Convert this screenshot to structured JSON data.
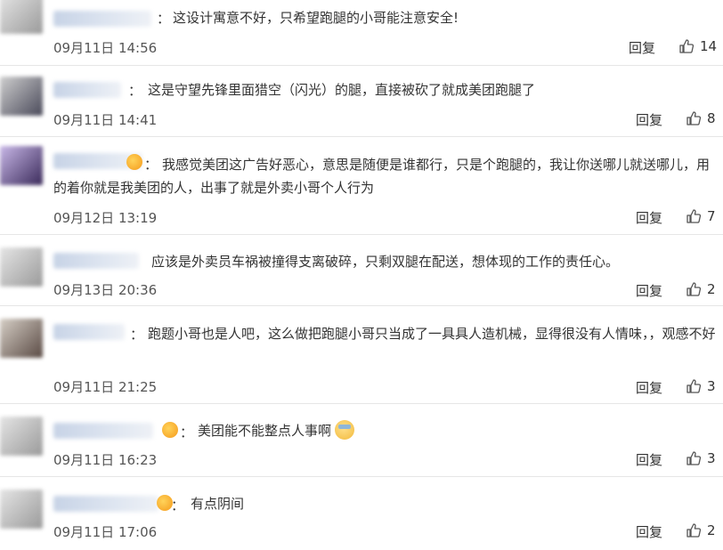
{
  "comments": [
    {
      "text": "这设计寓意不好，只希望跑腿的小哥能注意安全!",
      "time": "09月11日 14:56",
      "reply": "回复",
      "likes": "14"
    },
    {
      "text": "这是守望先锋里面猎空（闪光）的腿，直接被砍了就成美团跑腿了",
      "time": "09月11日 14:41",
      "reply": "回复",
      "likes": "8"
    },
    {
      "text": "我感觉美团这广告好恶心，意思是随便是谁都行，只是个跑腿的，我让你送哪儿就送哪儿，用的着你就是我美团的人，出事了就是外卖小哥个人行为",
      "time": "09月12日 13:19",
      "reply": "回复",
      "likes": "7"
    },
    {
      "text": "应该是外卖员车祸被撞得支离破碎，只剩双腿在配送，想体现的工作的责任心。",
      "time": "09月13日 20:36",
      "reply": "回复",
      "likes": "2"
    },
    {
      "text": "跑题小哥也是人吧，这么做把跑腿小哥只当成了一具具人造机械，显得很没有人情味，，观感不好",
      "time": "09月11日 21:25",
      "reply": "回复",
      "likes": "3"
    },
    {
      "text": "美团能不能整点人事啊",
      "time": "09月11日 16:23",
      "reply": "回复",
      "likes": "3"
    },
    {
      "text": "有点阴间",
      "time": "09月11日 17:06",
      "reply": "回复",
      "likes": "2"
    }
  ],
  "icons": {
    "like": "thumbs-up-icon",
    "badge": "vip-badge-icon",
    "emoji": "mask-face-emoji-icon"
  }
}
